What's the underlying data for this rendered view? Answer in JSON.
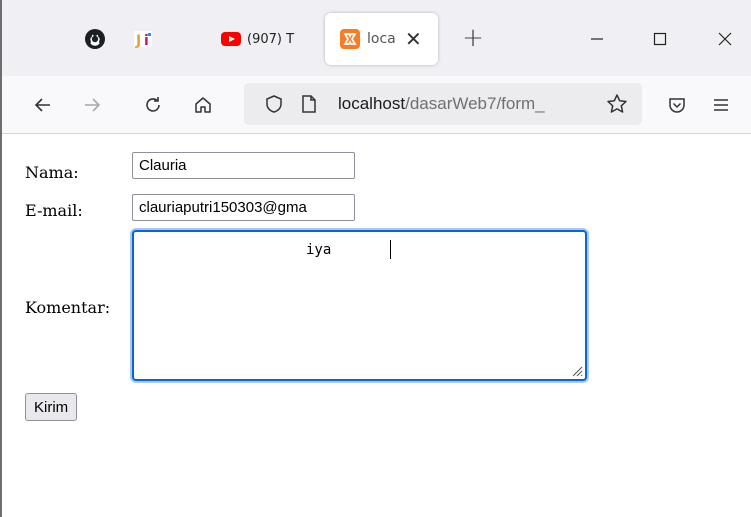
{
  "browser": {
    "tabs": [
      {
        "title": "",
        "icon": "github-icon"
      },
      {
        "title": "",
        "icon": "jetbrains-icon"
      },
      {
        "title": "(907) T",
        "icon": "youtube-icon"
      },
      {
        "title": "loca",
        "icon": "xampp-icon",
        "active": true
      }
    ],
    "tab_close_glyph": "✕",
    "new_tab_glyph": "+",
    "url_host": "localhost",
    "url_path": "/dasarWeb7/form_"
  },
  "form": {
    "nama_label": "Nama:",
    "nama_value": "Clauria",
    "email_label": "E-mail:",
    "email_value": "clauriaputri150303@gma",
    "komentar_label": "Komentar:",
    "komentar_value": "iya",
    "submit_label": "Kirim"
  },
  "colors": {
    "accent_focus": "#0a66d6",
    "youtube_red": "#ff0000",
    "xampp_orange": "#fb7a24"
  }
}
